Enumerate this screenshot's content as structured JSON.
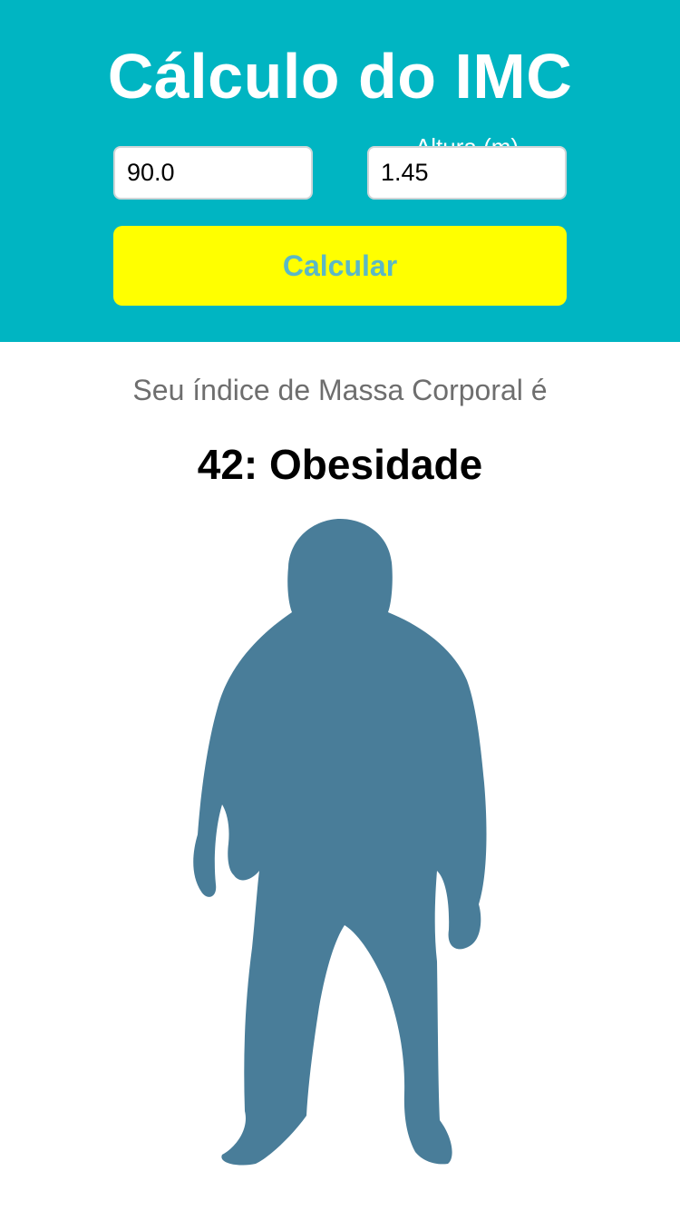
{
  "header": {
    "title": "Cálculo do IMC",
    "height_label": "Altura (m)"
  },
  "form": {
    "weight_value": "90.0",
    "height_value": "1.45",
    "calculate_label": "Calcular"
  },
  "result": {
    "caption": "Seu índice de Massa Corporal é",
    "value": "42: Obesidade",
    "figure_icon": "obese-person-silhouette-icon"
  },
  "colors": {
    "header_bg": "#00B5C2",
    "button_bg": "#FFFF00",
    "button_text": "#5BB8C6",
    "silhouette": "#497D99"
  }
}
